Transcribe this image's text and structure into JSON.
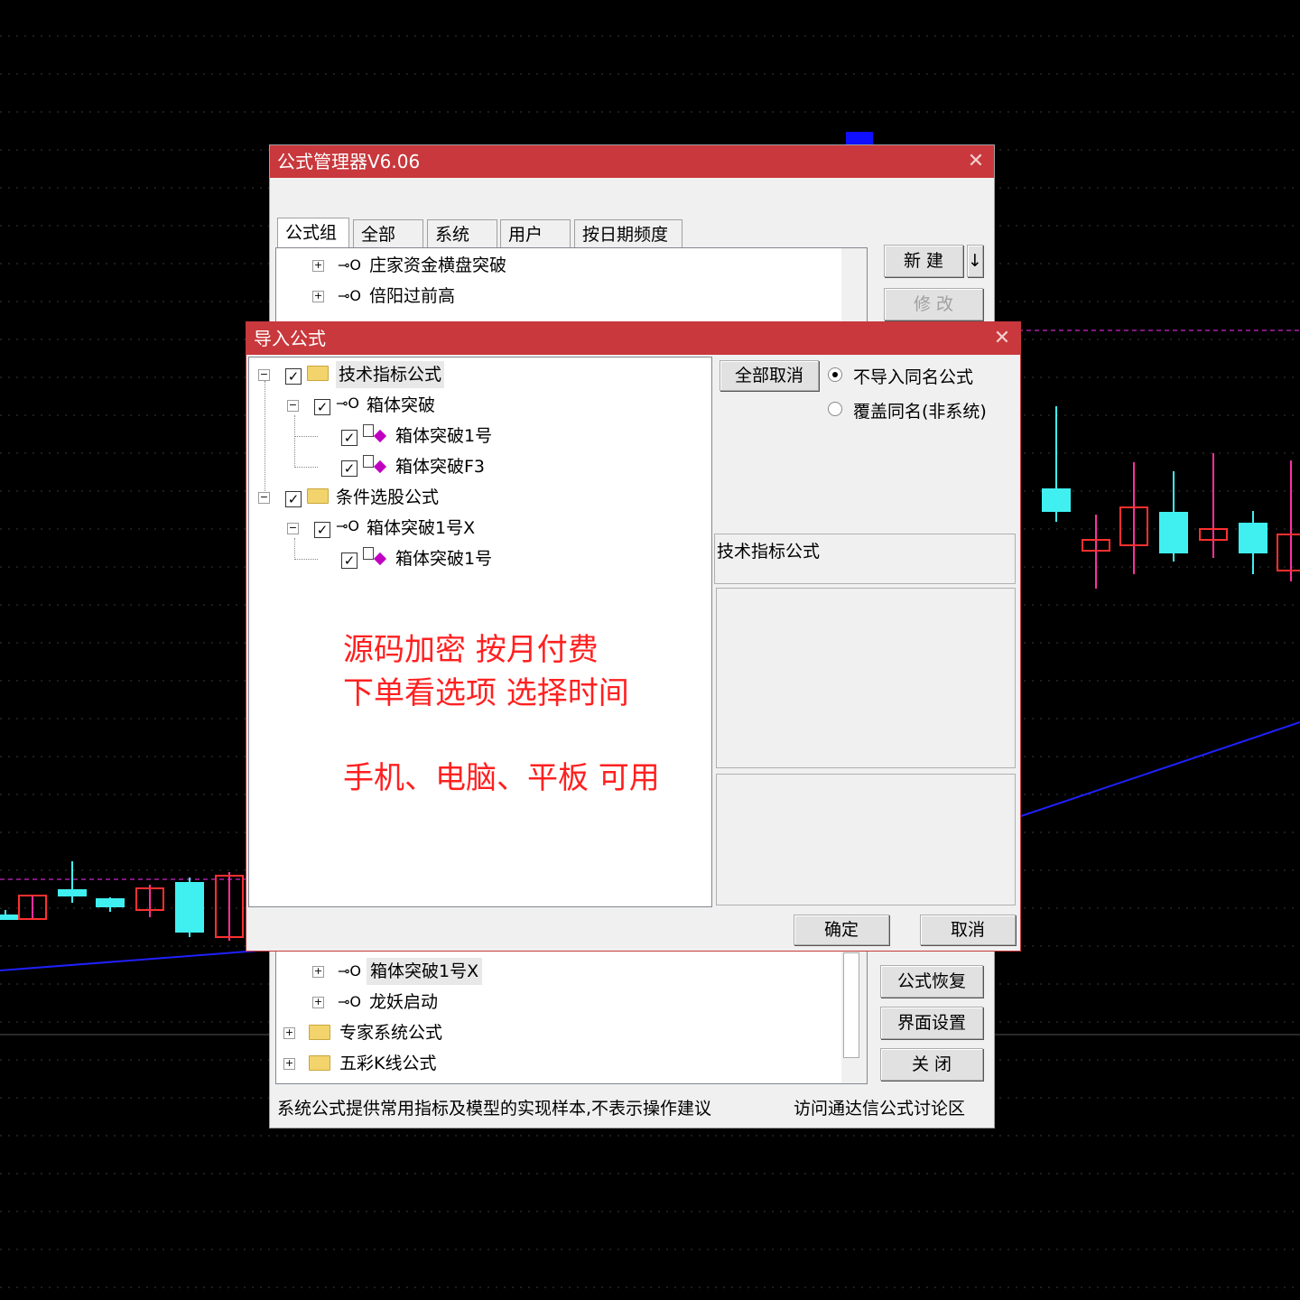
{
  "colors": {
    "titlebar": "#c8383c",
    "candle_up": "#ff3030",
    "candle_down": "#40f0f0",
    "trend": "#2020ff",
    "promo": "#ff2020"
  },
  "manager": {
    "title": "公式管理器V6.06",
    "tabs": [
      "公式组",
      "全部",
      "系统",
      "用户",
      "按日期频度"
    ],
    "tree_top": [
      {
        "label": "庄家资金横盘突破",
        "icon": "key-icon"
      },
      {
        "label": "倍阳过前高",
        "icon": "key-icon"
      }
    ],
    "tree_bottom": [
      {
        "label": "箱体突破1号X",
        "icon": "key-icon"
      },
      {
        "label": "龙妖启动",
        "icon": "key-icon"
      },
      {
        "label": "专家系统公式",
        "icon": "folder-icon"
      },
      {
        "label": "五彩K线公式",
        "icon": "folder-icon"
      }
    ],
    "buttons": {
      "new": "新 建",
      "new_arrow": "↓",
      "modify": "修 改",
      "restore": "公式恢复",
      "ui_settings": "界面设置",
      "close": "关 闭"
    },
    "status_left": "系统公式提供常用指标及模型的实现样本,不表示操作建议",
    "status_right": "访问通达信公式讨论区"
  },
  "import": {
    "title": "导入公式",
    "tree": [
      {
        "label": "技术指标公式",
        "level": 0,
        "type": "folder",
        "checked": true
      },
      {
        "label": "箱体突破",
        "level": 1,
        "type": "key",
        "checked": true
      },
      {
        "label": "箱体突破1号",
        "level": 2,
        "type": "item",
        "checked": true
      },
      {
        "label": "箱体突破F3",
        "level": 2,
        "type": "item",
        "checked": true
      },
      {
        "label": "条件选股公式",
        "level": 0,
        "type": "folder",
        "checked": true
      },
      {
        "label": "箱体突破1号X",
        "level": 1,
        "type": "key",
        "checked": true
      },
      {
        "label": "箱体突破1号",
        "level": 2,
        "type": "item",
        "checked": true
      }
    ],
    "promo_lines": [
      "源码加密  按月付费",
      "下单看选项  选择时间",
      "手机、电脑、平板 可用"
    ],
    "cancel_all": "全部取消",
    "radio": [
      {
        "label": "不导入同名公式",
        "selected": true
      },
      {
        "label": "覆盖同名(非系统)",
        "selected": false
      }
    ],
    "info_label": "技术指标公式",
    "ok": "确定",
    "cancel": "取消"
  }
}
